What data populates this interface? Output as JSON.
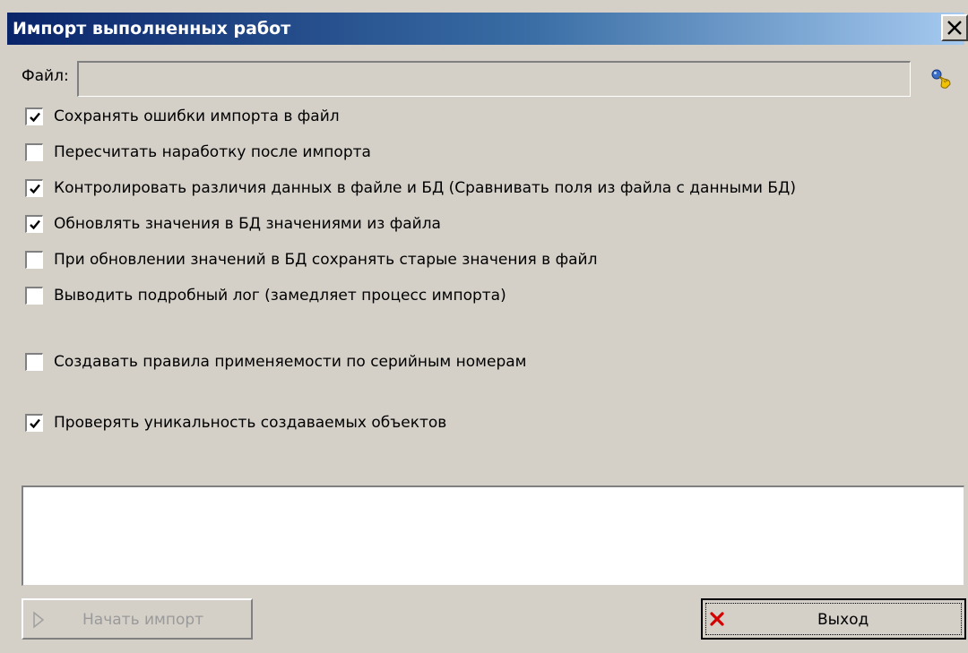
{
  "window": {
    "title": "Импорт выполненных работ"
  },
  "file": {
    "label": "Файл:",
    "value": ""
  },
  "icons": {
    "close": "close-icon",
    "browse": "browse-file-icon",
    "start": "play-icon",
    "exit": "red-x-icon"
  },
  "options": [
    {
      "label": "Сохранять ошибки импорта в файл",
      "checked": true
    },
    {
      "label": "Пересчитать наработку после импорта",
      "checked": false
    },
    {
      "label": "Контролировать различия данных в файле и БД (Сравнивать поля из файла с данными БД)",
      "checked": true
    },
    {
      "label": "Обновлять значения в БД значениями из файла",
      "checked": true
    },
    {
      "label": "При обновлении значений в БД сохранять старые значения в файл",
      "checked": false
    },
    {
      "label": "Выводить подробный лог (замедляет процесс импорта)",
      "checked": false
    },
    {
      "label": "Создавать правила применяемости по серийным номерам",
      "checked": false
    },
    {
      "label": "Проверять уникальность создаваемых объектов",
      "checked": true
    }
  ],
  "log": {
    "text": ""
  },
  "buttons": {
    "start_label": "Начать импорт",
    "start_enabled": false,
    "exit_label": "Выход"
  },
  "colors": {
    "title_gradient_start": "#0a246a",
    "title_gradient_end": "#a6caf0",
    "dialog_bg": "#d4d0c8",
    "exit_icon": "#d40000",
    "disabled_text": "#9a9a9a"
  }
}
